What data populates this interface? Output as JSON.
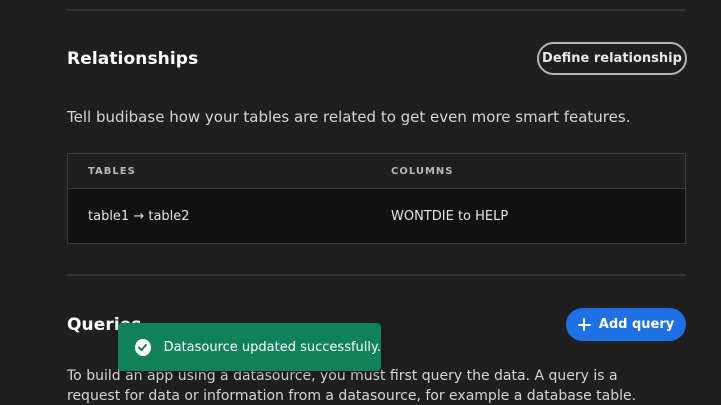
{
  "relationships": {
    "title": "Relationships",
    "define_button": "Define relationship",
    "description": "Tell budibase how your tables are related to get even more smart features.",
    "table": {
      "headers": [
        "TABLES",
        "COLUMNS"
      ],
      "rows": [
        {
          "tables": "table1 → table2",
          "columns": "WONTDIE to HELP"
        }
      ]
    }
  },
  "queries": {
    "title": "Queries",
    "add_button": "Add query",
    "description": "To build an app using a datasource, you must first query the data. A query is a request for data or information from a datasource, for example a database table."
  },
  "toast": {
    "message": "Datasource updated successfully.",
    "icon": "check-circle-icon"
  },
  "colors": {
    "background": "#1f1f1f",
    "accent": "#1f6fe5",
    "toast_success": "#11815a"
  }
}
